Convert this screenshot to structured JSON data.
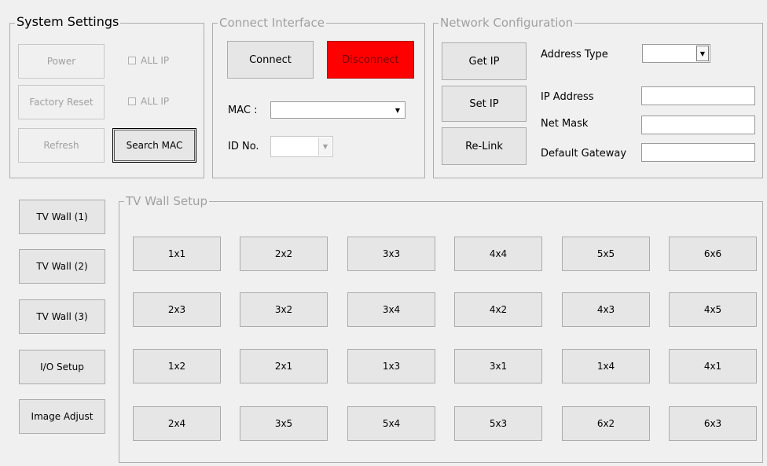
{
  "system_settings": {
    "title": "System Settings",
    "power_label": "Power",
    "factory_reset_label": "Factory Reset",
    "refresh_label": "Refresh",
    "search_mac_label": "Search MAC",
    "power_allip_label": "ALL IP",
    "factory_allip_label": "ALL IP"
  },
  "connect_interface": {
    "title": "Connect Interface",
    "connect_label": "Connect",
    "disconnect_label": "Disconnect",
    "disconnect_color": "#ff0000",
    "mac_label": "MAC :",
    "mac_value": "",
    "id_label": "ID No.",
    "id_value": ""
  },
  "network_configuration": {
    "title": "Network Configuration",
    "get_ip_label": "Get IP",
    "set_ip_label": "Set IP",
    "relink_label": "Re-Link",
    "address_type_label": "Address Type",
    "address_type_value": "",
    "ip_address_label": "IP Address",
    "ip_address_value": "",
    "net_mask_label": "Net Mask",
    "net_mask_value": "",
    "gateway_label": "Default Gateway",
    "gateway_value": ""
  },
  "side_nav": [
    {
      "label": "TV Wall (1)"
    },
    {
      "label": "TV Wall (2)"
    },
    {
      "label": "TV Wall (3)"
    },
    {
      "label": "I/O Setup"
    },
    {
      "label": "Image Adjust"
    }
  ],
  "tv_wall_setup": {
    "title": "TV Wall Setup",
    "rows": [
      [
        "1x1",
        "2x2",
        "3x3",
        "4x4",
        "5x5",
        "6x6"
      ],
      [
        "2x3",
        "3x2",
        "3x4",
        "4x2",
        "4x3",
        "4x5"
      ],
      [
        "1x2",
        "2x1",
        "1x3",
        "3x1",
        "1x4",
        "4x1"
      ],
      [
        "2x4",
        "3x5",
        "5x4",
        "5x3",
        "6x2",
        "6x3"
      ]
    ]
  }
}
